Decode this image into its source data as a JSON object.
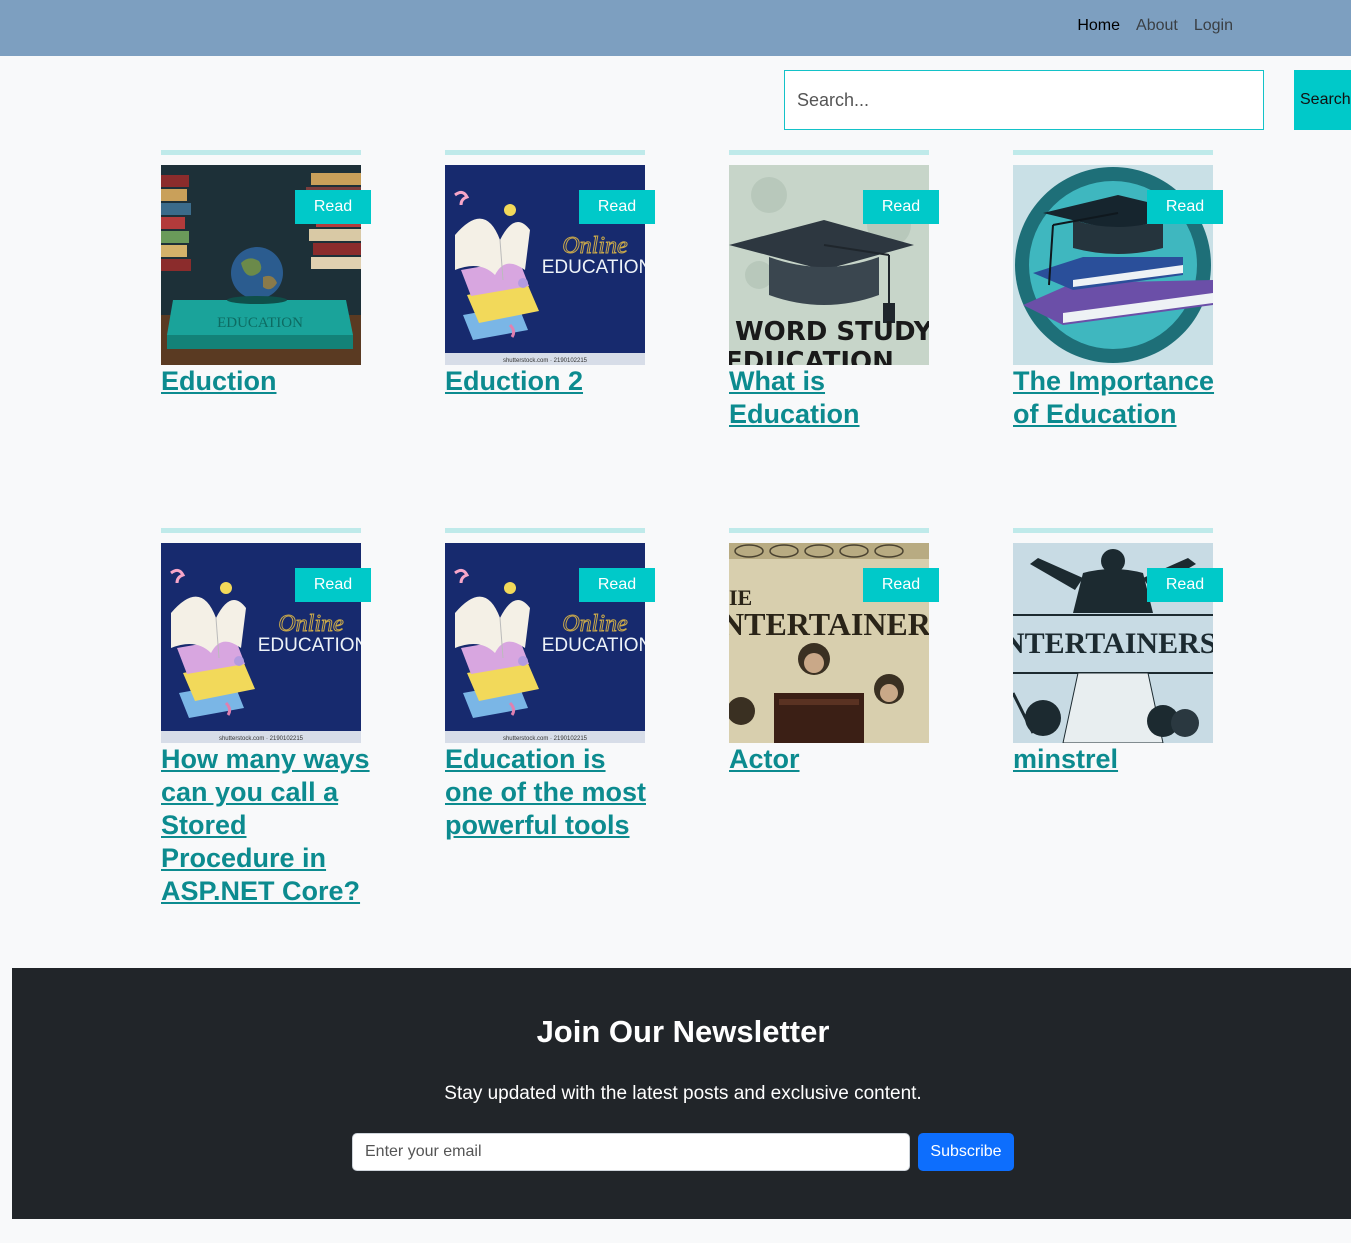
{
  "nav": {
    "links": [
      "Home",
      "About",
      "Login"
    ]
  },
  "search": {
    "placeholder": "Search...",
    "button_label": "Search"
  },
  "posts": [
    {
      "title": "Eduction",
      "button": "Read",
      "image": "globe-on-book-education"
    },
    {
      "title": "Eduction 2",
      "button": "Read",
      "image": "online-education-books"
    },
    {
      "title": "What is Education",
      "button": "Read",
      "image": "graduation-cap-word-study",
      "image_text": [
        "WORD STUDY:",
        "EDUCATION"
      ]
    },
    {
      "title": "The Importance of Education",
      "button": "Read",
      "image": "cap-on-books-teal-circle"
    },
    {
      "title": "How many ways can you call a Stored Procedure in ASP.NET Core?",
      "button": "Read",
      "image": "online-education-books"
    },
    {
      "title": "Education is one of the most powerful tools",
      "button": "Read",
      "image": "online-education-books"
    },
    {
      "title": "Actor",
      "button": "Read",
      "image": "entertainers-poster",
      "image_text": [
        "IE",
        "NTERTAINERS"
      ]
    },
    {
      "title": "minstrel",
      "button": "Read",
      "image": "entertainers-illustration",
      "image_text": [
        "NTERTAINERS"
      ]
    }
  ],
  "online_edu_image_text": {
    "script": "Online",
    "word": "EDUCATION",
    "footer": "shutterstock.com · 2190102215"
  },
  "education_book_text": "EDUCATION",
  "newsletter": {
    "title": "Join Our Newsletter",
    "subtitle": "Stay updated with the latest posts and exclusive content.",
    "email_placeholder": "Enter your email",
    "button_label": "Subscribe"
  },
  "colors": {
    "navbar": "#7d9fc0",
    "accent": "#00c9c9",
    "link": "#0c8b8f",
    "footer": "#212529",
    "subscribe": "#0d6efd"
  }
}
